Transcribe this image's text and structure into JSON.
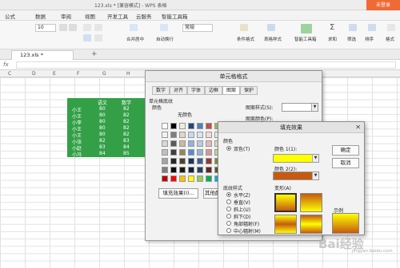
{
  "titlebar": {
    "doc_title": "123.xls * [兼容模式] - WPS 表格",
    "login_label": "未登录"
  },
  "menu": {
    "items": [
      "公式",
      "数据",
      "审阅",
      "视图",
      "开发工具",
      "云服务",
      "智能工具箱"
    ]
  },
  "ribbon": {
    "font_size": "10",
    "number_format": "常规",
    "labels": {
      "merge_center": "合并居中",
      "wrap_text": "自动换行",
      "cond_format": "条件格式",
      "table_style": "表格样式",
      "smart_toolbox": "智能工具箱",
      "sum": "求和",
      "filter": "筛选",
      "sort": "排序",
      "format": "格式"
    }
  },
  "sheet_tab": {
    "name": "123.xls *",
    "add": "+"
  },
  "formula_bar": {
    "fx": "fx"
  },
  "columns": [
    "C",
    "D",
    "E",
    "F",
    "G",
    "H"
  ],
  "table": {
    "headers": [
      "语文",
      "数学"
    ],
    "rows": [
      [
        "小王",
        "80",
        "82"
      ],
      [
        "小王",
        "80",
        "82"
      ],
      [
        "小李",
        "80",
        "82"
      ],
      [
        "小王",
        "80",
        "82"
      ],
      [
        "小王",
        "80",
        "82"
      ],
      [
        "小张",
        "82",
        "83"
      ],
      [
        "小赵",
        "83",
        "84"
      ],
      [
        "小冯",
        "84",
        "85"
      ]
    ]
  },
  "dialog_format": {
    "title": "单元格格式",
    "tabs": [
      "数字",
      "对齐",
      "字体",
      "边框",
      "图案",
      "保护"
    ],
    "section_shading": "单元格底纹",
    "label_color": "颜色",
    "no_color": "无颜色",
    "pattern_style": "图案样式(S):",
    "pattern_color": "图案颜色(P):",
    "fill_effects_button": "填充效果(I)...",
    "other_colors_button": "其他颜色"
  },
  "dialog_fill": {
    "title": "填充效果",
    "colors_label": "颜色",
    "two_colors": "双色(T)",
    "color1_label": "颜色 1(1):",
    "color2_label": "颜色 2(2):",
    "color1": "#ffff00",
    "color2": "#c55a11",
    "ok": "确定",
    "cancel": "取消",
    "shading_styles_label": "底纹样式",
    "styles": [
      "水平(Z)",
      "垂直(V)",
      "斜上(U)",
      "斜下(D)",
      "角部辐射(F)",
      "中心辐射(M)"
    ],
    "selected_style": "水平(Z)",
    "variants_label": "变形(A)",
    "sample_label": "示例"
  }
}
